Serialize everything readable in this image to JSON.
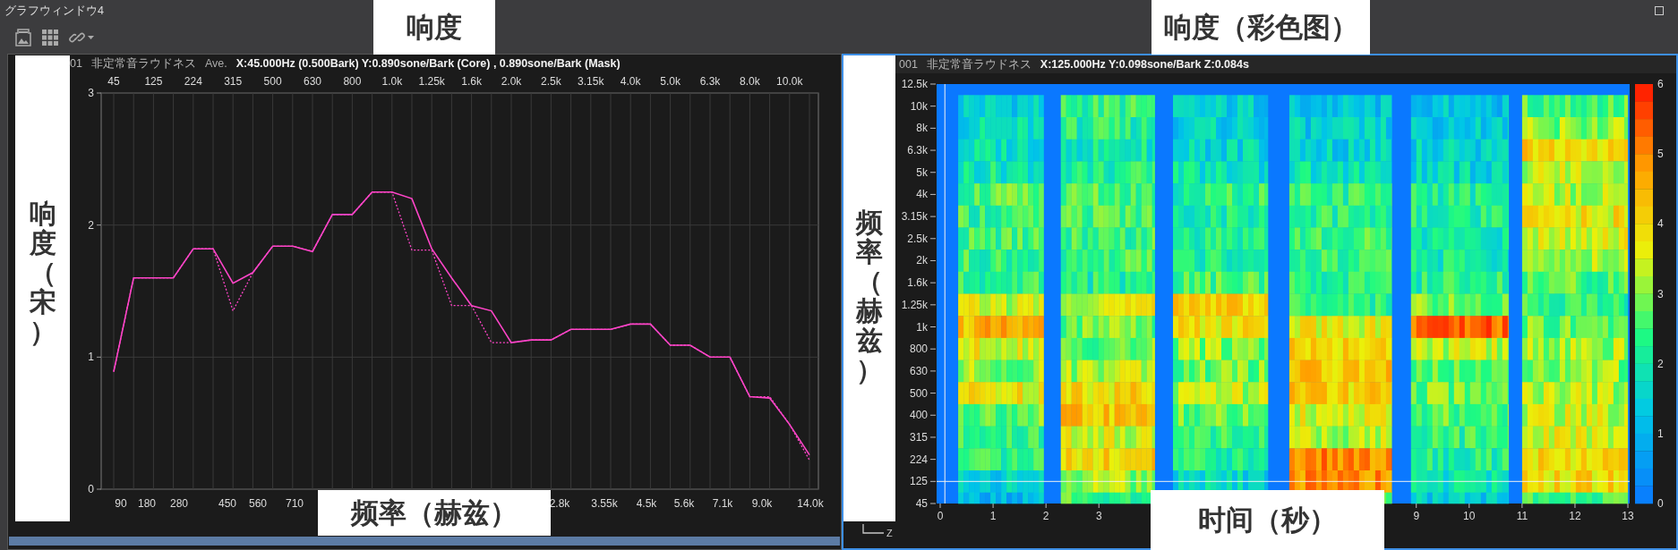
{
  "window": {
    "title": "グラフウィンドウ4"
  },
  "overlay_labels": [
    {
      "text": "响度",
      "kind": "horizontal"
    },
    {
      "text": "响度（彩色图）",
      "kind": "horizontal"
    },
    {
      "text": "响度（宋）",
      "kind": "vertical"
    },
    {
      "text": "频率（赫兹）",
      "kind": "vertical"
    },
    {
      "text": "频率（赫兹）",
      "kind": "horizontal"
    },
    {
      "text": "时间（秒）",
      "kind": "horizontal"
    }
  ],
  "left_panel": {
    "active": false,
    "header": {
      "id": "01",
      "title": "非定常音ラウドネス",
      "mode": "Ave.",
      "reading": "X:45.000Hz (0.500Bark) Y:0.890sone/Bark (Core) , 0.890sone/Bark (Mask)"
    },
    "bottom_axis_labels": [
      "90",
      "180",
      "280",
      "450",
      "560",
      "710",
      "2.8k",
      "3.55k",
      "4.5k",
      "5.6k",
      "7.1k",
      "9.0k",
      "14.0k"
    ],
    "chart_data": {
      "type": "line",
      "grid": true,
      "ylim": [
        0,
        3
      ],
      "yticks": [
        0,
        1,
        2,
        3
      ],
      "categories": [
        "45",
        null,
        "125",
        null,
        "224",
        null,
        "315",
        null,
        "500",
        null,
        "630",
        null,
        "800",
        null,
        "1.0k",
        null,
        "1.25k",
        null,
        "1.6k",
        null,
        "2.0k",
        null,
        "2.5k",
        null,
        "3.15k",
        null,
        "4.0k",
        null,
        "5.0k",
        null,
        "6.3k",
        null,
        "8.0k",
        null,
        "10.0k",
        null
      ],
      "series": [
        {
          "color": "#ff45c8",
          "line_style": "solid",
          "values": [
            0.89,
            1.6,
            1.6,
            1.6,
            1.82,
            1.82,
            1.56,
            1.64,
            1.84,
            1.84,
            1.8,
            2.08,
            2.08,
            2.25,
            2.25,
            2.2,
            1.82,
            1.6,
            1.39,
            1.35,
            1.11,
            1.13,
            1.13,
            1.21,
            1.21,
            1.21,
            1.25,
            1.25,
            1.09,
            1.09,
            1.0,
            1.0,
            0.7,
            0.69,
            0.49,
            0.26
          ]
        },
        {
          "color": "#ff45c8",
          "line_style": "dotted",
          "values": [
            0.89,
            1.6,
            1.6,
            1.6,
            1.82,
            1.82,
            1.35,
            1.64,
            1.84,
            1.84,
            1.8,
            2.08,
            2.08,
            2.25,
            2.25,
            1.81,
            1.81,
            1.39,
            1.39,
            1.11,
            1.11,
            1.13,
            1.13,
            1.21,
            1.21,
            1.21,
            1.25,
            1.25,
            1.09,
            1.09,
            1.0,
            1.0,
            0.7,
            0.7,
            0.49,
            0.22
          ]
        }
      ]
    }
  },
  "right_panel": {
    "active": true,
    "header": {
      "id": "001",
      "title": "非定常音ラウドネス",
      "reading": "X:125.000Hz Y:0.098sone/Bark Z:0.084s"
    },
    "y_axis_labels": [
      "12.5k",
      "10k",
      "8k",
      "6.3k",
      "5k",
      "4k",
      "3.15k",
      "2.5k",
      "2k",
      "1.6k",
      "1.25k",
      "1k",
      "800",
      "630",
      "500",
      "400",
      "315",
      "224",
      "125",
      "45"
    ],
    "x_axis_labels": [
      "0",
      "1",
      "2",
      "3",
      "9",
      "10",
      "11",
      "12",
      "13"
    ],
    "colorbar_labels": [
      "6",
      "5",
      "4",
      "3",
      "2",
      "1",
      "0"
    ],
    "z_label": "Z"
  }
}
